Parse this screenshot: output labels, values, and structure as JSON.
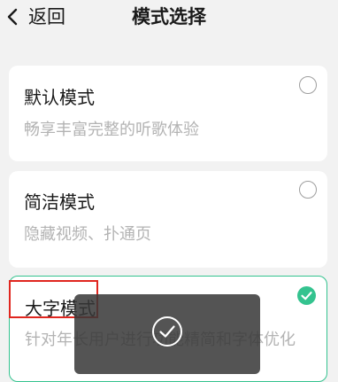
{
  "header": {
    "back_label": "返回",
    "title": "模式选择"
  },
  "modes": [
    {
      "title": "默认模式",
      "description": "畅享丰富完整的听歌体验",
      "selected": false
    },
    {
      "title": "简洁模式",
      "description": "隐藏视频、扑通页",
      "selected": false
    },
    {
      "title": "大字模式",
      "description": "针对年长用户进行功能精简和字体优化",
      "selected": true
    }
  ],
  "colors": {
    "accent": "#34c38f",
    "highlight": "#e0261f",
    "background": "#f2f2f2"
  },
  "toast": {
    "icon": "check-circle-icon"
  }
}
